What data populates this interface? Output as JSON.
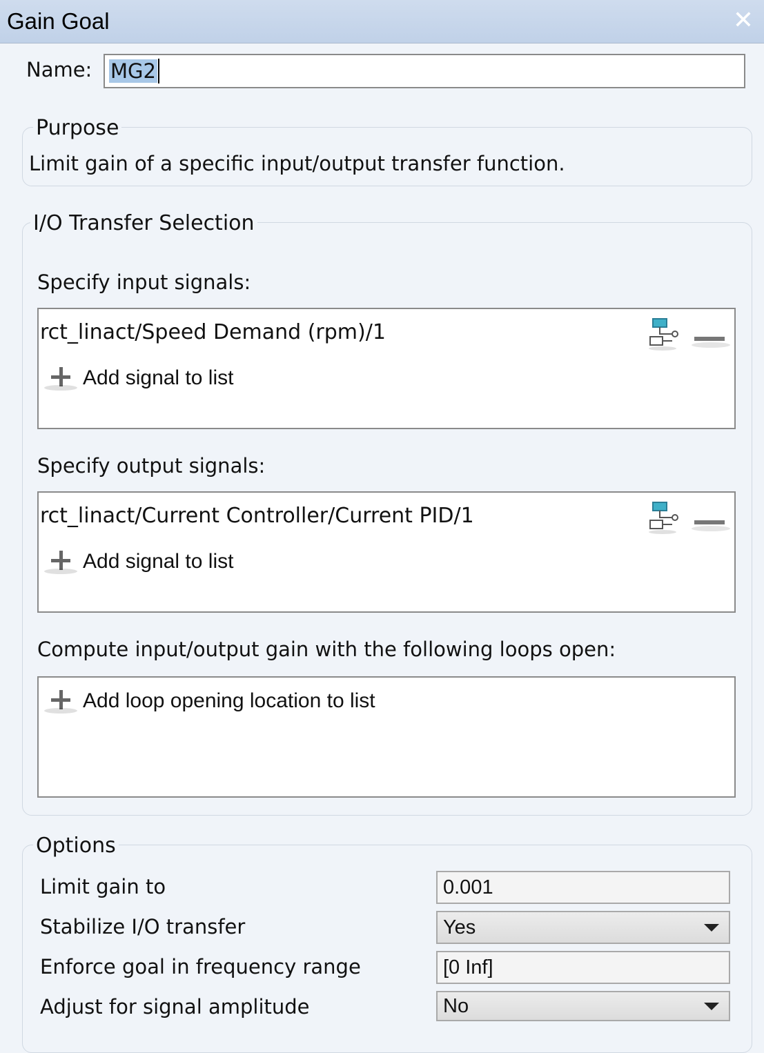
{
  "window": {
    "title": "Gain Goal",
    "close_symbol": "✕"
  },
  "name": {
    "label": "Name:",
    "value": "MG2"
  },
  "purpose": {
    "legend": "Purpose",
    "text": "Limit gain of a specific input/output transfer function."
  },
  "io": {
    "legend": "I/O Transfer Selection",
    "inputs_label": "Specify input signals:",
    "inputs": [
      "rct_linact/Speed Demand (rpm)/1"
    ],
    "outputs_label": "Specify output signals:",
    "outputs": [
      "rct_linact/Current Controller/Current PID/1"
    ],
    "add_signal_label": "Add signal to list",
    "loops_label": "Compute input/output gain with the following loops open:",
    "add_loop_label": "Add loop opening location to list"
  },
  "options": {
    "legend": "Options",
    "limit_gain_label": "Limit gain to",
    "limit_gain_value": "0.001",
    "stabilize_label": "Stabilize I/O transfer",
    "stabilize_value": "Yes",
    "freq_range_label": "Enforce goal in frequency range",
    "freq_range_value": "[0 Inf]",
    "amplitude_label": "Adjust for signal amplitude",
    "amplitude_value": "No"
  },
  "colors": {
    "titlebar": "#c0d1e8",
    "icon_teal": "#3fb0c8",
    "selection": "#a8c8e8"
  },
  "icons": [
    "close-icon",
    "signal-select-icon",
    "remove-icon",
    "plus-icon",
    "dropdown-arrow-icon"
  ]
}
